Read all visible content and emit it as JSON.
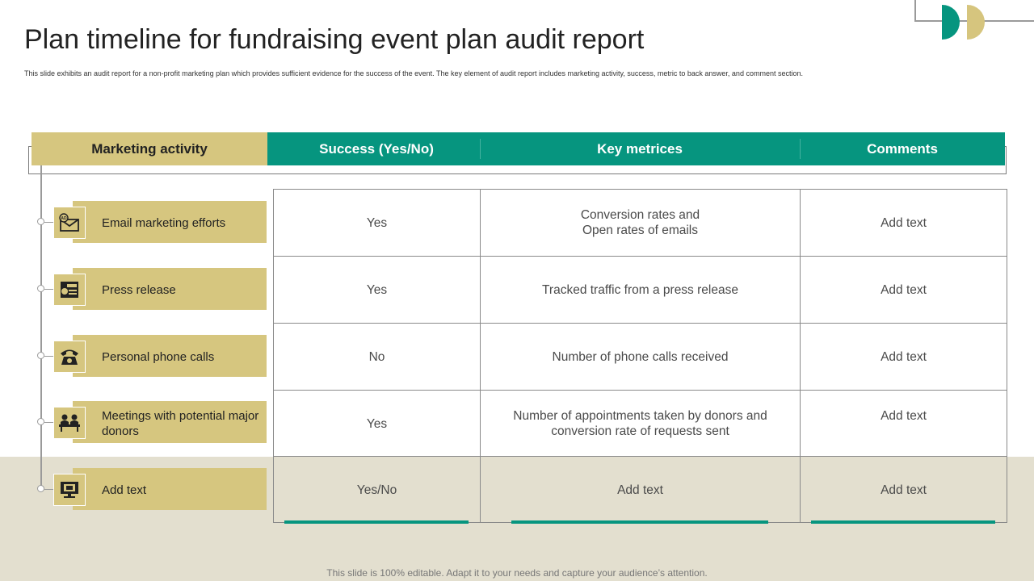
{
  "slide": {
    "title": "Plan timeline for fundraising event plan audit report",
    "subtitle": "This slide exhibits an audit report for a non-profit marketing plan which provides sufficient evidence for the success of the event. The key element of audit report includes marketing activity, success, metric to back answer, and comment section.",
    "footer": "This slide is 100% editable. Adapt it to your needs and capture your audience’s attention."
  },
  "table": {
    "headers": {
      "activity": "Marketing activity",
      "success": "Success (Yes/No)",
      "metrics": "Key metrices",
      "comments": "Comments"
    },
    "rows": [
      {
        "activity": "Email marketing efforts",
        "icon": "email-ad-icon",
        "success": "Yes",
        "metrics": "Conversion rates and\nOpen rates of emails",
        "comments": "Add text"
      },
      {
        "activity": "Press release",
        "icon": "press-release-icon",
        "success": "Yes",
        "metrics": "Tracked traffic from a press release",
        "comments": "Add text"
      },
      {
        "activity": "Personal phone calls",
        "icon": "phone-icon",
        "success": "No",
        "metrics": "Number of phone calls received",
        "comments": "Add text"
      },
      {
        "activity": "Meetings with potential major donors",
        "icon": "meeting-icon",
        "success": "Yes",
        "metrics": "Number of appointments taken by donors and conversion rate of requests sent",
        "comments": "Add text"
      },
      {
        "activity": "Add text",
        "icon": "monitor-icon",
        "success": "Yes/No",
        "metrics": "Add text",
        "comments": "Add text"
      }
    ]
  },
  "colors": {
    "teal": "#06957f",
    "gold": "#d6c67f",
    "band": "#e3dfcf"
  }
}
